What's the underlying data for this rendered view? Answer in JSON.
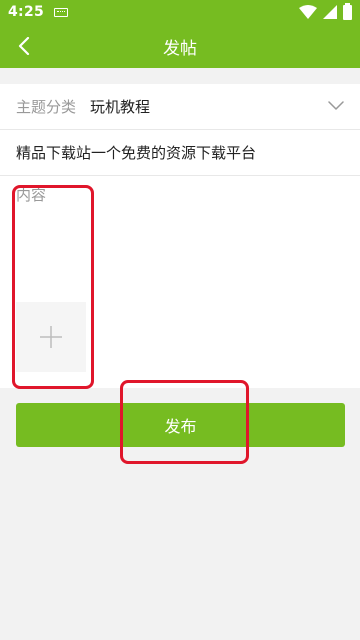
{
  "status_bar": {
    "time": "4:25",
    "icons": [
      "keyboard-icon",
      "wifi-icon",
      "signal-icon",
      "battery-icon"
    ]
  },
  "app_bar": {
    "title": "发帖",
    "back_icon": "back-arrow-icon"
  },
  "form": {
    "category_label": "主题分类",
    "category_value": "玩机教程",
    "title_value": "精品下载站一个免费的资源下载平台",
    "content_placeholder": "内容",
    "add_image_icon": "plus-icon"
  },
  "publish_label": "发布",
  "colors": {
    "primary": "#76bc21",
    "annotation": "#e0162b",
    "background": "#f2f2f2"
  }
}
